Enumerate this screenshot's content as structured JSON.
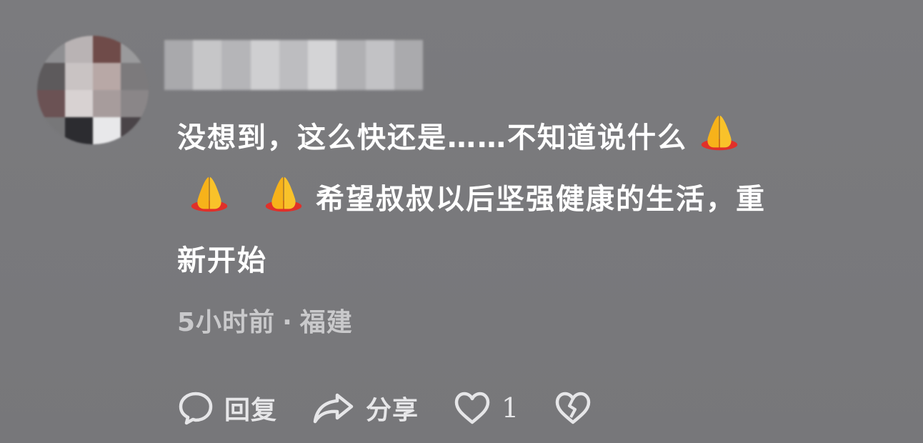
{
  "comment": {
    "line1_text": "没想到，这么快还是……不知道说什么",
    "line2_text": "希望叔叔以后坚强健康的生活，重",
    "line3_text": "新开始",
    "emoji_name": "folded-hands-icon"
  },
  "meta": {
    "time": "5小时前",
    "separator": "·",
    "location": "福建"
  },
  "actions": {
    "reply_label": "回复",
    "share_label": "分享",
    "like_count": "1"
  },
  "colors": {
    "background": "#7a7a7d",
    "comment_text": "#ffffff",
    "meta_text": "#c9c9cb",
    "action_text": "#e6e6e8"
  }
}
